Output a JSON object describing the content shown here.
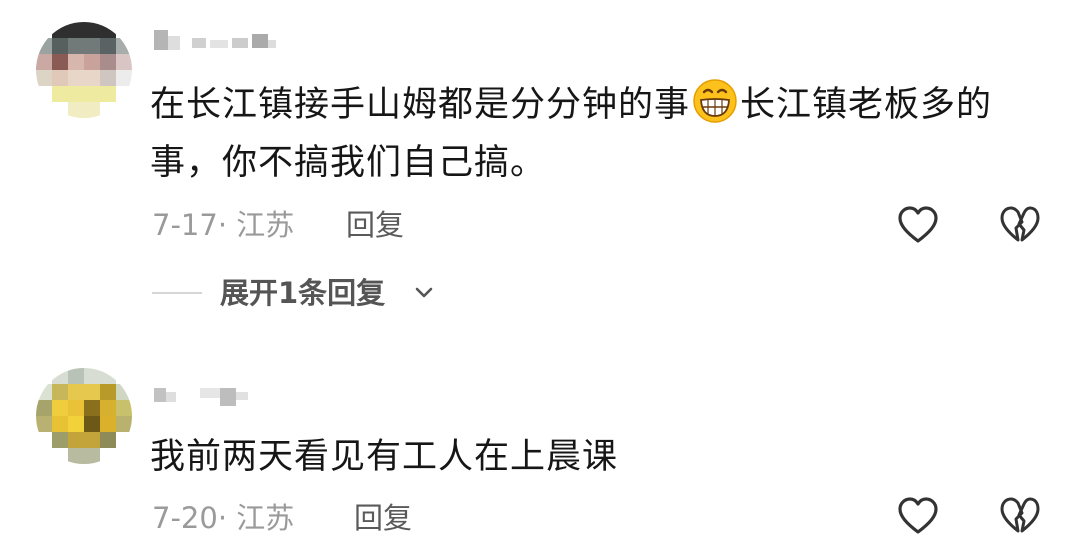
{
  "comments": [
    {
      "text_part1": "在长江镇接手山姆都是分分钟的事",
      "emoji": "grinning-face-emoji",
      "text_part2": "长江镇老板多的事，你不搞我们自己搞。",
      "date_location": "7-17· 江苏",
      "reply_label": "回复",
      "expand_label": "展开1条回复"
    },
    {
      "text": "我前两天看见有工人在上晨课",
      "date_location": "7-20· 江苏",
      "reply_label": "回复"
    }
  ],
  "icons": {
    "like": "heart-outline-icon",
    "dislike": "broken-heart-icon",
    "expand": "chevron-down-icon"
  },
  "colors": {
    "text": "#161616",
    "meta": "#9a9a9a",
    "icon": "#333333",
    "divider": "#d6d6d6"
  }
}
